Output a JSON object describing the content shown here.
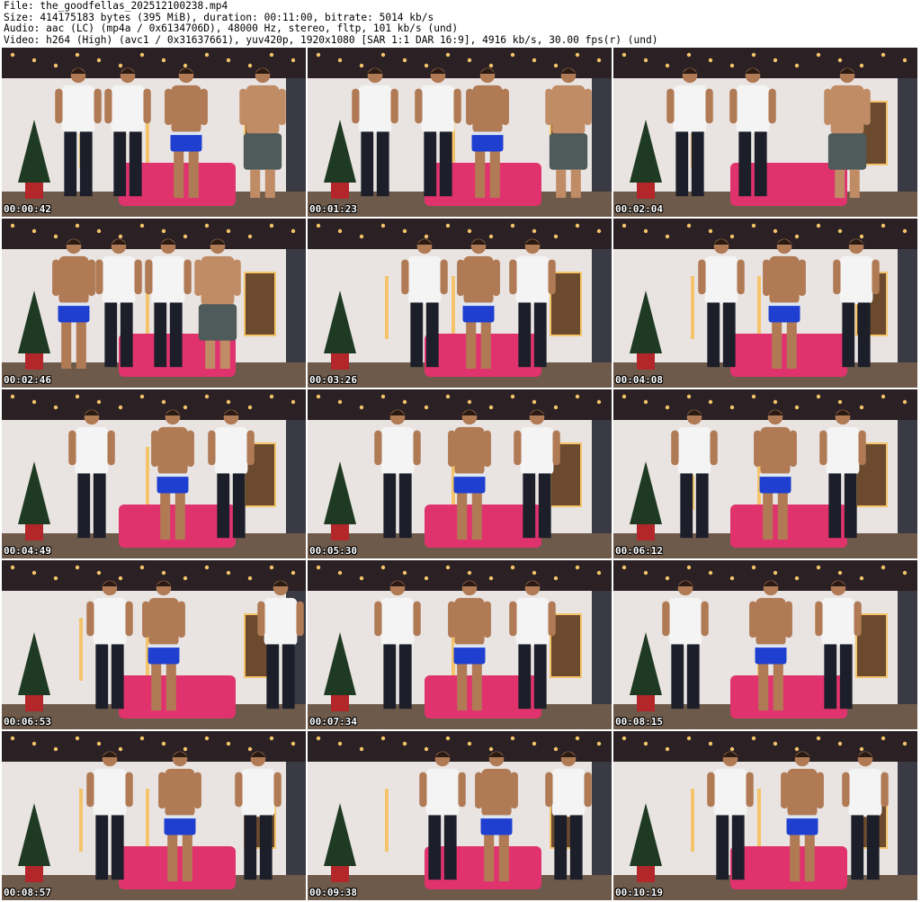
{
  "header": {
    "file": "File: the_goodfellas_202512100238.mp4",
    "size": "Size: 414175183 bytes (395 MiB), duration: 00:11:00, bitrate: 5014 kb/s",
    "audio": "Audio: aac (LC) (mp4a / 0x6134706D), 48000 Hz, stereo, fltp, 101 kb/s (und)",
    "video": "Video: h264 (High) (avc1 / 0x31637661), yuv420p, 1920x1080 [SAR 1:1 DAR 16:9], 4916 kb/s, 30.00 fps(r) (und)"
  },
  "thumbnails": [
    {
      "timestamp": "00:00:42"
    },
    {
      "timestamp": "00:01:23"
    },
    {
      "timestamp": "00:02:04"
    },
    {
      "timestamp": "00:02:46"
    },
    {
      "timestamp": "00:03:26"
    },
    {
      "timestamp": "00:04:08"
    },
    {
      "timestamp": "00:04:49"
    },
    {
      "timestamp": "00:05:30"
    },
    {
      "timestamp": "00:06:12"
    },
    {
      "timestamp": "00:06:53"
    },
    {
      "timestamp": "00:07:34"
    },
    {
      "timestamp": "00:08:15"
    },
    {
      "timestamp": "00:08:57"
    },
    {
      "timestamp": "00:09:38"
    },
    {
      "timestamp": "00:10:19"
    }
  ],
  "colors": {
    "ceiling": "#2b2124",
    "wall": "#e9e4e2",
    "floor": "#6e5a4a",
    "bed": "#e0336e",
    "shorts": "#1e3fcf",
    "shirt": "#f4f4f4",
    "skin": "#b07a55",
    "pants": "#1c1f2a",
    "tree": "#1f3a22",
    "lamp": "#f3c46a"
  }
}
